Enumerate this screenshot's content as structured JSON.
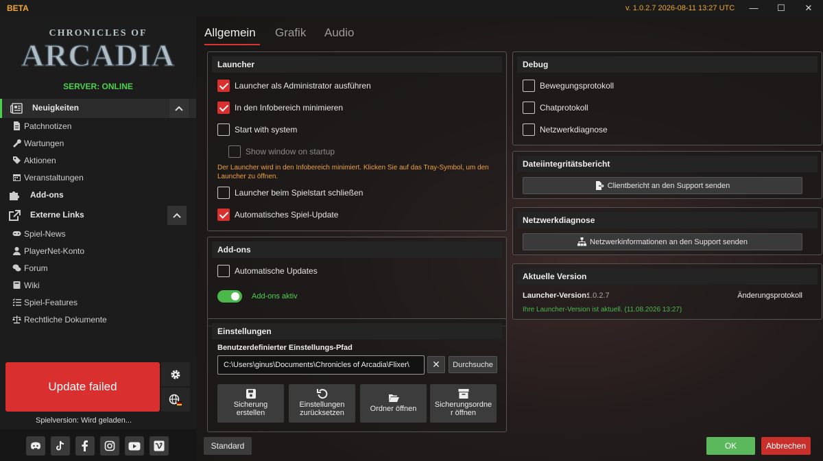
{
  "titlebar": {
    "badge": "BETA",
    "version_text": "v. 1.0.2.7  2026-08-11 13:27 UTC",
    "minimize_glyph": "—",
    "maximize_glyph": "☐",
    "close_glyph": "✕"
  },
  "sidebar": {
    "logo_top": "CHRONICLES OF",
    "logo_main": "ARCADIA",
    "server_status": "SERVER: ONLINE",
    "news": {
      "label": "Neuigkeiten",
      "items": [
        "Patchnotizen",
        "Wartungen",
        "Aktionen",
        "Veranstaltungen"
      ]
    },
    "addons_label": "Add-ons",
    "external": {
      "label": "Externe Links",
      "items": [
        "Spiel-News",
        "PlayerNet-Konto",
        "Forum",
        "Wiki",
        "Spiel-Features",
        "Rechtliche Dokumente"
      ]
    },
    "update_status": "Update failed",
    "game_version": "Spielversion: Wird geladen...",
    "social_icons": [
      "discord-icon",
      "tiktok-icon",
      "facebook-icon",
      "instagram-icon",
      "youtube-icon",
      "vimeo-icon"
    ]
  },
  "tabs": [
    "Allgemein",
    "Grafik",
    "Audio"
  ],
  "launcher": {
    "title": "Launcher",
    "options": {
      "admin": "Launcher als Administrator ausführen",
      "tray": "In den Infobereich minimieren",
      "start_system": "Start with system",
      "show_window": "Show window on startup",
      "close_on_start": "Launcher beim Spielstart schließen",
      "auto_update": "Automatisches Spiel-Update"
    },
    "tray_note": "Der Launcher wird in den Infobereich minimiert. Klicken Sie auf das Tray-Symbol, um den Launcher zu öffnen."
  },
  "addons": {
    "title": "Add-ons",
    "auto_updates": "Automatische Updates",
    "toggle_label": "Add-ons aktiv"
  },
  "settings": {
    "title": "Einstellungen",
    "path_label": "Benutzerdefinierter Einstellungs-Pfad",
    "path_value": "C:\\Users\\ginus\\Documents\\Chronicles of Arcadia\\Flixer\\",
    "clear_glyph": "✕",
    "browse": "Durchsuche",
    "buttons": {
      "backup_1": "Sicherung",
      "backup_2": "erstellen",
      "reset_1": "Einstellungen",
      "reset_2": "zurücksetzen",
      "open_folder": "Ordner öffnen",
      "backup_folder_1": "Sicherungsordne",
      "backup_folder_2": "r öffnen"
    }
  },
  "debug": {
    "title": "Debug",
    "options": [
      "Bewegungsprotokoll",
      "Chatprotokoll",
      "Netzwerkdiagnose"
    ]
  },
  "integrity": {
    "title": "Dateiintegritätsbericht",
    "button": "Clientbericht an den Support senden"
  },
  "netdiag": {
    "title": "Netzwerkdiagnose",
    "button": "Netzwerkinformationen an den Support senden"
  },
  "version": {
    "title": "Aktuelle Version",
    "label": "Launcher-Version:",
    "value": "1.0.2.7",
    "changelog": "Änderungsprotokoll",
    "status": "Ihre Launcher-Version ist aktuell. (11.08.2026 13:27)"
  },
  "footer": {
    "default": "Standard",
    "ok": "OK",
    "cancel": "Abbrechen"
  },
  "colors": {
    "accent_red": "#d9302f",
    "accent_green": "#4cd24c",
    "warning_orange": "#f0a040"
  }
}
